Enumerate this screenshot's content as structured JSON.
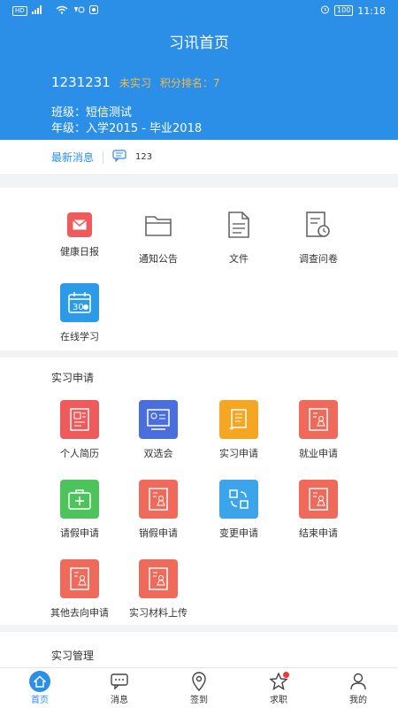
{
  "statusbar": {
    "left_badge": "HD",
    "signal": "⁴ᴳ",
    "battery": "100",
    "time": "11:18"
  },
  "header": {
    "title": "习讯首页",
    "user_id": "1231231",
    "status": "未实习",
    "rank": "积分排名：7",
    "class": "班级：短信测试",
    "year": "年级：入学2015 - 毕业2018"
  },
  "news": {
    "label": "最新消息",
    "text": "123"
  },
  "section1": {
    "items": [
      {
        "label": "健康日报",
        "color": "#ef5b5b"
      },
      {
        "label": "通知公告",
        "color": "#666666"
      },
      {
        "label": "文件",
        "color": "#666666"
      },
      {
        "label": "调查问卷",
        "color": "#666666"
      },
      {
        "label": "在线学习",
        "color": "#2b9be8",
        "icon_text": "30"
      }
    ]
  },
  "section2": {
    "title": "实习申请",
    "items": [
      {
        "label": "个人简历",
        "color": "#ef5b5b"
      },
      {
        "label": "双选会",
        "color": "#4a6fdc"
      },
      {
        "label": "实习申请",
        "color": "#f5a623"
      },
      {
        "label": "就业申请",
        "color": "#ef6a5b"
      },
      {
        "label": "请假申请",
        "color": "#4cc45b"
      },
      {
        "label": "销假申请",
        "color": "#ef6a5b"
      },
      {
        "label": "变更申请",
        "color": "#3ba4ea"
      },
      {
        "label": "结束申请",
        "color": "#ef6a5b"
      },
      {
        "label": "其他去向申请",
        "color": "#ef6a5b"
      },
      {
        "label": "实习材料上传",
        "color": "#ef6a5b"
      }
    ]
  },
  "section3": {
    "title": "实习管理"
  },
  "nav": [
    {
      "label": "首页"
    },
    {
      "label": "消息"
    },
    {
      "label": "签到"
    },
    {
      "label": "求职"
    },
    {
      "label": "我的"
    }
  ]
}
